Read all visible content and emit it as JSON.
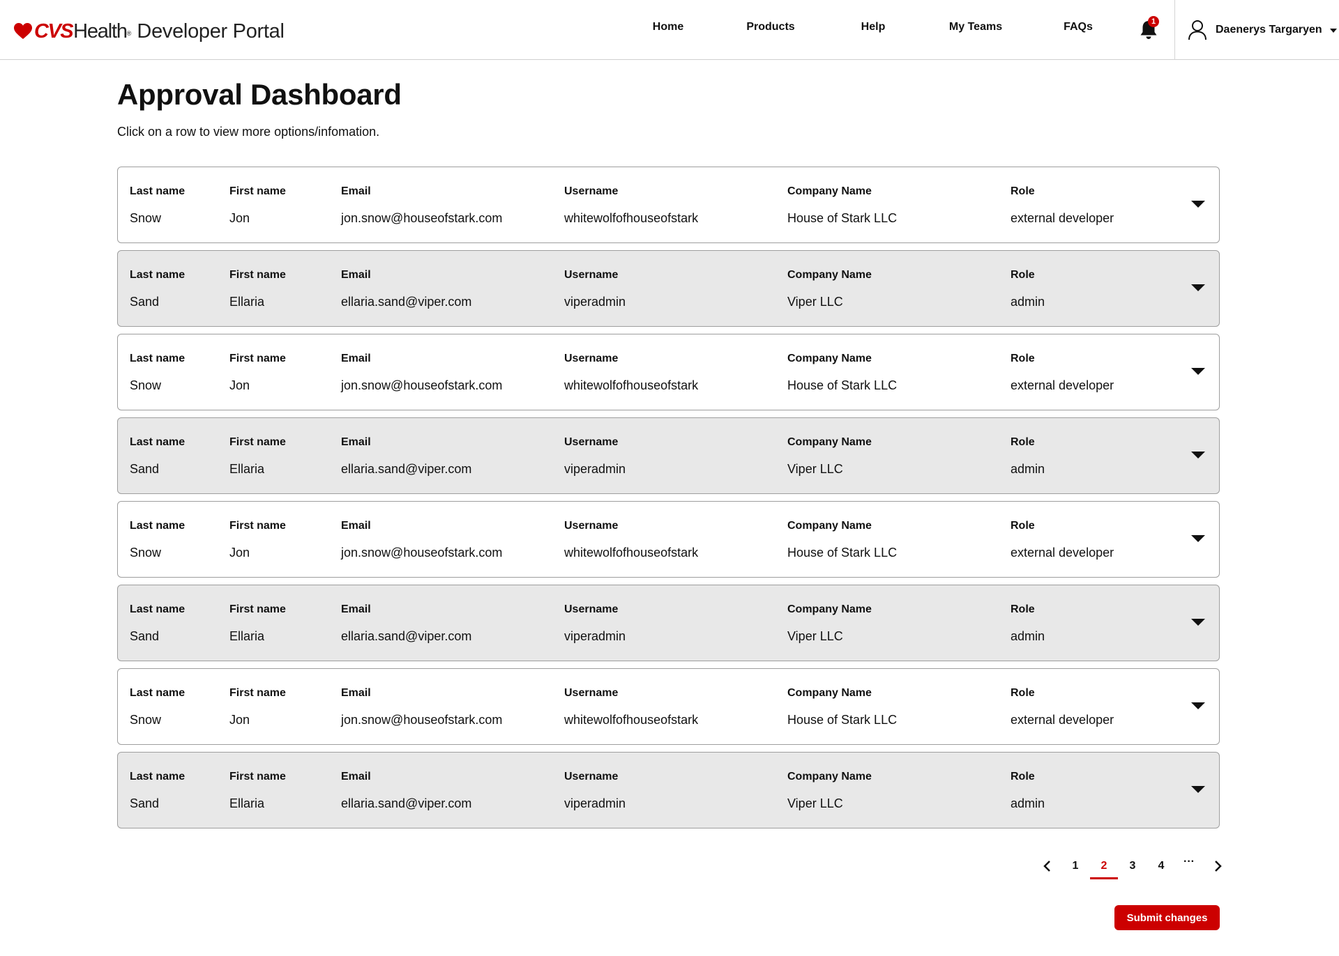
{
  "header": {
    "logo": {
      "brand": "CVS",
      "brand_suffix": "Health",
      "registered": "®",
      "product": "Developer Portal"
    },
    "nav": [
      {
        "label": "Home"
      },
      {
        "label": "Products"
      },
      {
        "label": "Help"
      },
      {
        "label": "My Teams"
      },
      {
        "label": "FAQs"
      }
    ],
    "notifications": {
      "count": "1"
    },
    "user": {
      "name": "Daenerys Targaryen"
    }
  },
  "page": {
    "title": "Approval Dashboard",
    "subtitle": "Click on a row to view more options/infomation."
  },
  "columns": {
    "last_name": "Last name",
    "first_name": "First name",
    "email": "Email",
    "username": "Username",
    "company": "Company Name",
    "role": "Role"
  },
  "rows": [
    {
      "last_name": "Snow",
      "first_name": "Jon",
      "email": "jon.snow@houseofstark.com",
      "username": "whitewolfofhouseofstark",
      "company": "House of Stark LLC",
      "role": "external developer"
    },
    {
      "last_name": "Sand",
      "first_name": "Ellaria",
      "email": "ellaria.sand@viper.com",
      "username": "viperadmin",
      "company": "Viper LLC",
      "role": "admin"
    },
    {
      "last_name": "Snow",
      "first_name": "Jon",
      "email": "jon.snow@houseofstark.com",
      "username": "whitewolfofhouseofstark",
      "company": "House of Stark LLC",
      "role": "external developer"
    },
    {
      "last_name": "Sand",
      "first_name": "Ellaria",
      "email": "ellaria.sand@viper.com",
      "username": "viperadmin",
      "company": "Viper LLC",
      "role": "admin"
    },
    {
      "last_name": "Snow",
      "first_name": "Jon",
      "email": "jon.snow@houseofstark.com",
      "username": "whitewolfofhouseofstark",
      "company": "House of Stark LLC",
      "role": "external developer"
    },
    {
      "last_name": "Sand",
      "first_name": "Ellaria",
      "email": "ellaria.sand@viper.com",
      "username": "viperadmin",
      "company": "Viper LLC",
      "role": "admin"
    },
    {
      "last_name": "Snow",
      "first_name": "Jon",
      "email": "jon.snow@houseofstark.com",
      "username": "whitewolfofhouseofstark",
      "company": "House of Stark LLC",
      "role": "external developer"
    },
    {
      "last_name": "Sand",
      "first_name": "Ellaria",
      "email": "ellaria.sand@viper.com",
      "username": "viperadmin",
      "company": "Viper LLC",
      "role": "admin"
    }
  ],
  "pagination": {
    "pages": [
      "1",
      "2",
      "3",
      "4"
    ],
    "current": "2",
    "ellipsis": "···"
  },
  "actions": {
    "submit_label": "Submit changes"
  },
  "colors": {
    "accent": "#cc0000",
    "row_alt": "#e8e8e8",
    "border": "#9e9e9e"
  },
  "icons": [
    "heart-logo-icon",
    "bell-icon",
    "user-icon",
    "chevron-down-icon",
    "chevron-left-icon",
    "chevron-right-icon"
  ]
}
